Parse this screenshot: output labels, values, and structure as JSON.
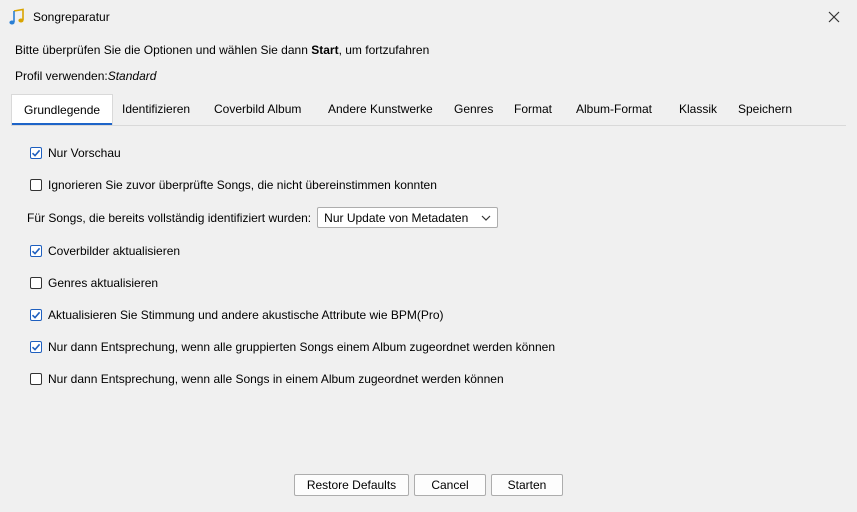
{
  "window": {
    "title": "Songreparatur"
  },
  "header": {
    "instruction_pre": "Bitte überprüfen Sie die Optionen und wählen Sie dann ",
    "instruction_bold": "Start",
    "instruction_post": ", um fortzufahren",
    "profile_label": "Profil verwenden:",
    "profile_value": "Standard"
  },
  "tabs": [
    {
      "label": "Grundlegende",
      "active": true
    },
    {
      "label": "Identifizieren"
    },
    {
      "label": "Coverbild Album"
    },
    {
      "label": "Andere Kunstwerke"
    },
    {
      "label": "Genres"
    },
    {
      "label": "Format"
    },
    {
      "label": "Album-Format"
    },
    {
      "label": "Klassik"
    },
    {
      "label": "Speichern"
    }
  ],
  "options": [
    {
      "label": "Nur Vorschau",
      "checked": true
    },
    {
      "label": "Ignorieren Sie zuvor überprüfte Songs, die nicht übereinstimmen konnten",
      "checked": false
    },
    {
      "label": "Coverbilder aktualisieren",
      "checked": true
    },
    {
      "label": "Genres aktualisieren",
      "checked": false
    },
    {
      "label": "Aktualisieren Sie Stimmung und andere akustische Attribute wie BPM(Pro)",
      "checked": true
    },
    {
      "label": "Nur dann Entsprechung, wenn alle gruppierten Songs einem Album zugeordnet werden können",
      "checked": true
    },
    {
      "label": "Nur dann Entsprechung, wenn alle Songs in einem Album zugeordnet werden können",
      "checked": false
    }
  ],
  "identified_songs": {
    "label": "Für Songs, die bereits vollständig identifiziert wurden:",
    "selected": "Nur Update von Metadaten"
  },
  "buttons": {
    "restore": "Restore Defaults",
    "cancel": "Cancel",
    "start": "Starten"
  },
  "colors": {
    "accent": "#1e64c8",
    "checkmark": "#1e5fbf"
  }
}
